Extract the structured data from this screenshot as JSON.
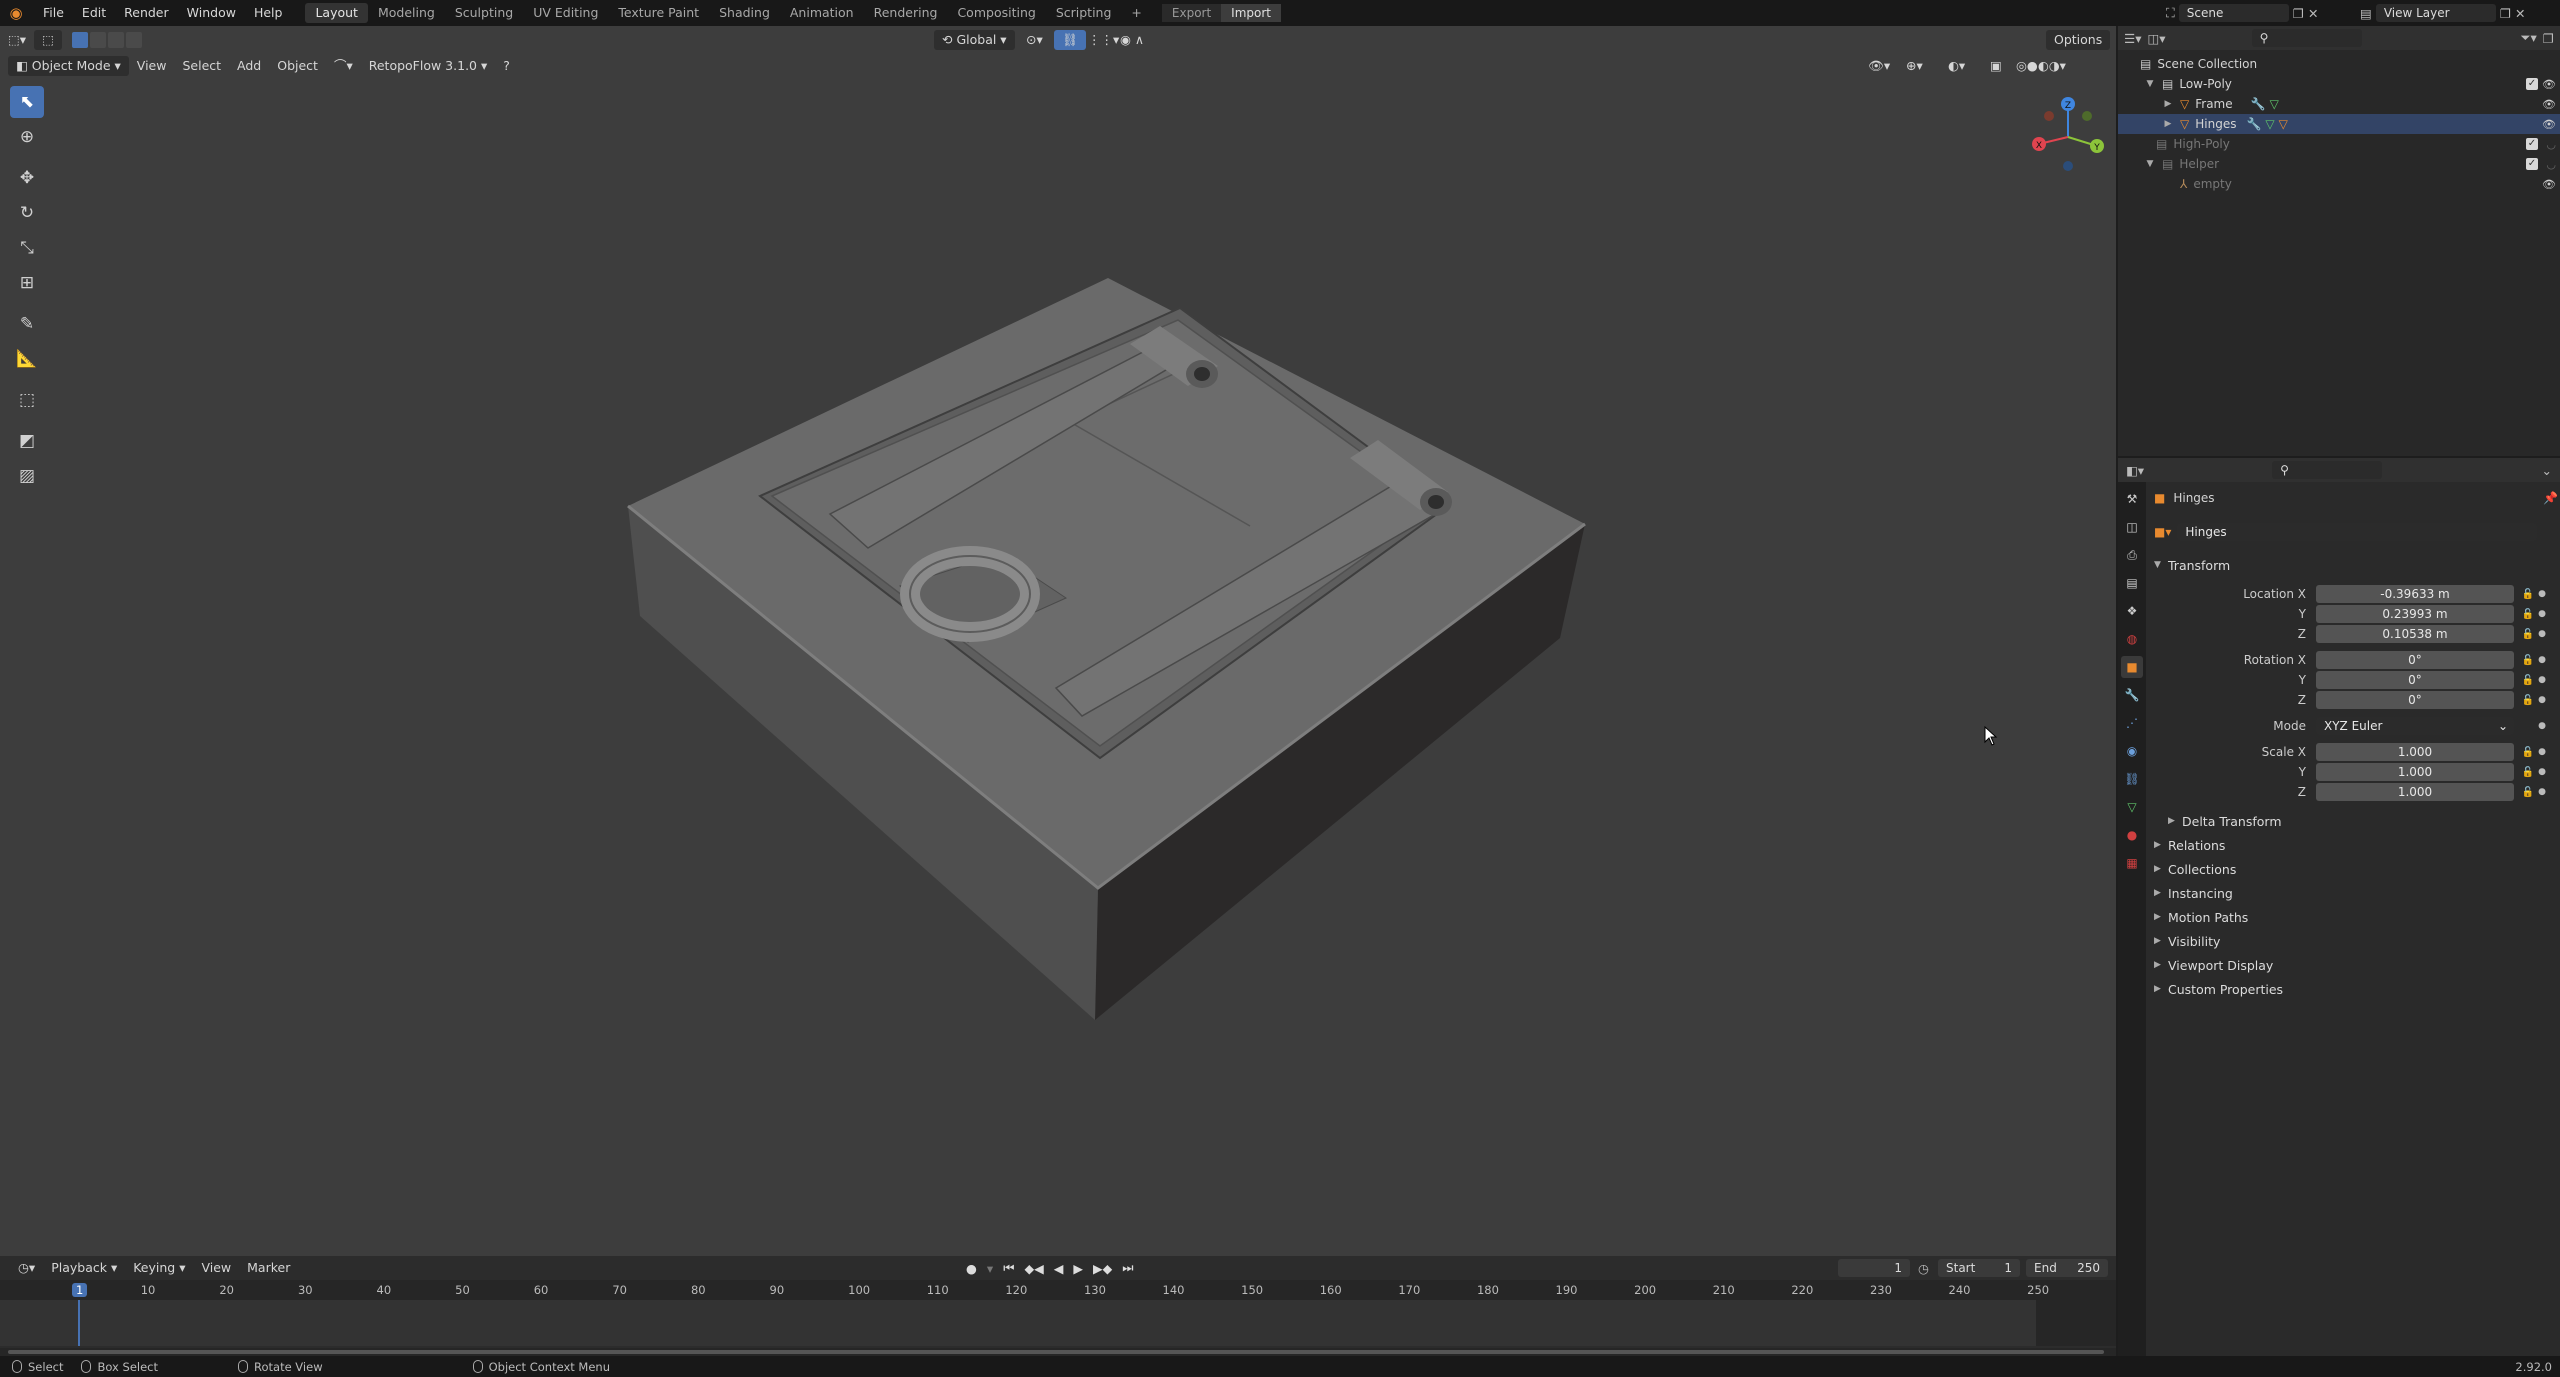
{
  "menus": [
    "File",
    "Edit",
    "Render",
    "Window",
    "Help"
  ],
  "workspaces": [
    "Layout",
    "Modeling",
    "Sculpting",
    "UV Editing",
    "Texture Paint",
    "Shading",
    "Animation",
    "Rendering",
    "Compositing",
    "Scripting"
  ],
  "export_label": "Export",
  "import_label": "Import",
  "scene_name": "Scene",
  "view_layer": "View Layer",
  "viewport": {
    "mode": "Object Mode",
    "view": "View",
    "select": "Select",
    "add": "Add",
    "object": "Object",
    "addon": "RetopoFlow 3.1.0",
    "orientation": "Global",
    "options": "Options"
  },
  "outliner": {
    "root": "Scene Collection",
    "items": [
      {
        "label": "Low-Poly"
      },
      {
        "label": "Frame"
      },
      {
        "label": "Hinges"
      },
      {
        "label": "High-Poly"
      },
      {
        "label": "Helper"
      },
      {
        "label": "empty"
      }
    ]
  },
  "properties": {
    "object_name": "Hinges",
    "data_name": "Hinges",
    "transform_title": "Transform",
    "location": {
      "label": "Location X",
      "x": "-0.39633 m",
      "y": "0.23993 m",
      "z": "0.10538 m"
    },
    "rotation": {
      "label": "Rotation X",
      "x": "0°",
      "y": "0°",
      "z": "0°"
    },
    "mode_label": "Mode",
    "mode_value": "XYZ Euler",
    "scale": {
      "label": "Scale X",
      "x": "1.000",
      "y": "1.000",
      "z": "1.000"
    },
    "axis_y": "Y",
    "axis_z": "Z",
    "delta": "Delta Transform",
    "panels": [
      "Relations",
      "Collections",
      "Instancing",
      "Motion Paths",
      "Visibility",
      "Viewport Display",
      "Custom Properties"
    ]
  },
  "timeline": {
    "menus": [
      "Playback",
      "Keying",
      "View",
      "Marker"
    ],
    "current_frame": "1",
    "start_label": "Start",
    "start": "1",
    "end_label": "End",
    "end": "250",
    "ruler": [
      "1",
      "10",
      "20",
      "30",
      "40",
      "50",
      "60",
      "70",
      "80",
      "90",
      "100",
      "110",
      "120",
      "130",
      "140",
      "150",
      "160",
      "170",
      "180",
      "190",
      "200",
      "210",
      "220",
      "230",
      "240",
      "250"
    ]
  },
  "status": {
    "select": "Select",
    "box_select": "Box Select",
    "rotate": "Rotate View",
    "context": "Object Context Menu",
    "version": "2.92.0"
  },
  "colors": {
    "accent": "#4772b3",
    "gizmo_x": "#e0444f",
    "gizmo_y": "#8cc43a",
    "gizmo_z": "#3f86e0"
  }
}
